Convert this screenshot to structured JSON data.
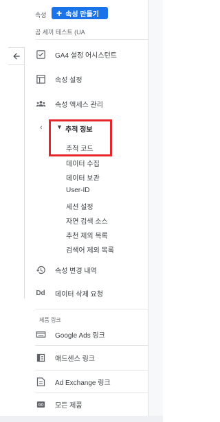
{
  "header": {
    "property_label": "속성",
    "create_property_button": "속성 만들기",
    "account_name": "곰 세끼 테스트 (UA"
  },
  "nav": {
    "items": [
      {
        "label": "GA4 설정 어시스턴트",
        "icon": "checkbox-icon"
      },
      {
        "label": "속성 설정",
        "icon": "settings-window-icon"
      },
      {
        "label": "속성 액세스 관리",
        "icon": "people-icon"
      }
    ],
    "tracking_section": {
      "label": "추적 정보",
      "subitems": [
        "추적 코드",
        "데이터 수집",
        "데이터 보관",
        "User-ID",
        "세션 설정",
        "자연 검색 소스",
        "추천 제외 목록",
        "검색어 제외 목록"
      ]
    },
    "change_history": {
      "label": "속성 변경 내역",
      "icon": "history-icon"
    },
    "data_deletion": {
      "label": "데이터 삭제 요청",
      "icon": "dd-icon"
    }
  },
  "product_links": {
    "heading": "제품 링크",
    "items": [
      {
        "label": "Google Ads 링크",
        "icon": "google-ads-icon"
      },
      {
        "label": "애드센스 링크",
        "icon": "adsense-icon"
      },
      {
        "label": "Ad Exchange 링크",
        "icon": "ad-exchange-icon"
      },
      {
        "label": "모든 제품",
        "icon": "all-products-icon"
      }
    ]
  }
}
